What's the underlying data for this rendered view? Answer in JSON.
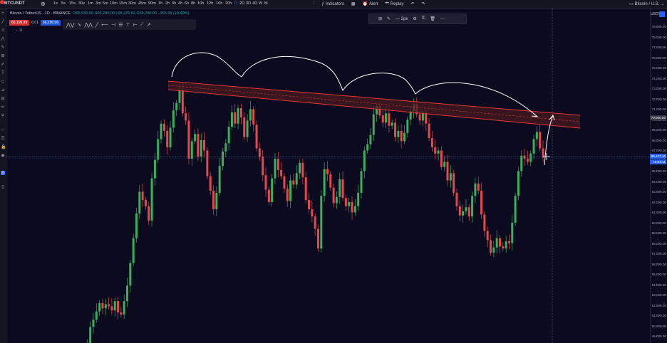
{
  "topbar": {
    "symbol": "BTCUSDT",
    "add_symbol_icon": "plus-circle-icon",
    "intervals": [
      "1s",
      "5s",
      "15s",
      "30s",
      "1m",
      "3m",
      "5m",
      "10m",
      "15m",
      "30m",
      "45m",
      "90m",
      "1h",
      "2h",
      "3h",
      "4h",
      "6h",
      "8h",
      "10h",
      "12h",
      "16h",
      "20h",
      "D",
      "2D",
      "3D",
      "4D",
      "W",
      "M"
    ],
    "active_interval": "D",
    "indicators_label": "Indicators",
    "alert_label": "Alert",
    "replay_label": "Replay",
    "right_title": "Bitcoin / U.S. ..."
  },
  "legend": {
    "title": "Bitcoin / TetherUS · 1D · BINANCE",
    "ohlc": "O65,936.00 H66,200.00 L65,476.84 C66,200.00 −265.99 (+0.40%)",
    "sell_price": "66,199.99",
    "spread": "0.01",
    "buy_price": "66,200.00",
    "vol_count": "11"
  },
  "line_toolbar": {
    "width_label": "2px"
  },
  "price_axis": {
    "currency": "USDT",
    "labels": [
      "79,000.00",
      "78,000.00",
      "77,000.00",
      "76,000.00",
      "75,000.00",
      "74,000.00",
      "73,000.00",
      "72,000.00",
      "71,000.00",
      "70,000.00",
      "69,000.00",
      "68,000.00",
      "67,000.00",
      "66,000.00",
      "65,000.00",
      "64,000.00",
      "63,000.00",
      "62,000.00",
      "61,000.00",
      "60,000.00",
      "59,000.00",
      "58,000.00",
      "57,000.00",
      "56,000.00",
      "55,000.00",
      "54,000.00",
      "53,000.00",
      "52,000.00",
      "51,000.00",
      "50,000.00",
      "49,000.00",
      "48,000.00"
    ],
    "current_price_label": "66,437.10",
    "countdown_label": "15:51:11",
    "crosshair_price_label": "70,000.00"
  },
  "colors": {
    "background": "#0b0a1e",
    "up": "#26a69a",
    "up_candle": "#3cae5c",
    "down_candle": "#e5484d",
    "channel_line": "#e53935",
    "channel_fill": "#4a1a22",
    "annotation": "#ffffff",
    "accent": "#2962ff"
  }
}
